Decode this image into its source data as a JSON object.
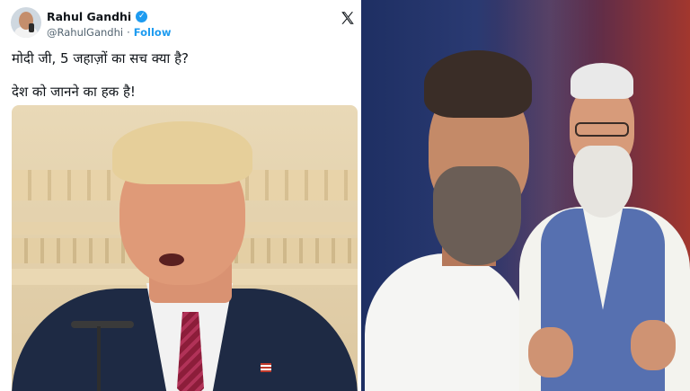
{
  "tweet": {
    "display_name": "Rahul Gandhi",
    "verified_mark": "✓",
    "handle": "@RahulGandhi",
    "separator": "·",
    "follow_label": "Follow",
    "line1": "मोदी जी, 5 जहाज़ों का सच क्या है?",
    "line2": "देश को जानने का हक है!",
    "icons": [
      "avatar",
      "verified-badge-icon",
      "x-logo-icon"
    ]
  },
  "colors": {
    "accent": "#1d9bf0",
    "text": "#0f1419",
    "muted": "#536471"
  }
}
